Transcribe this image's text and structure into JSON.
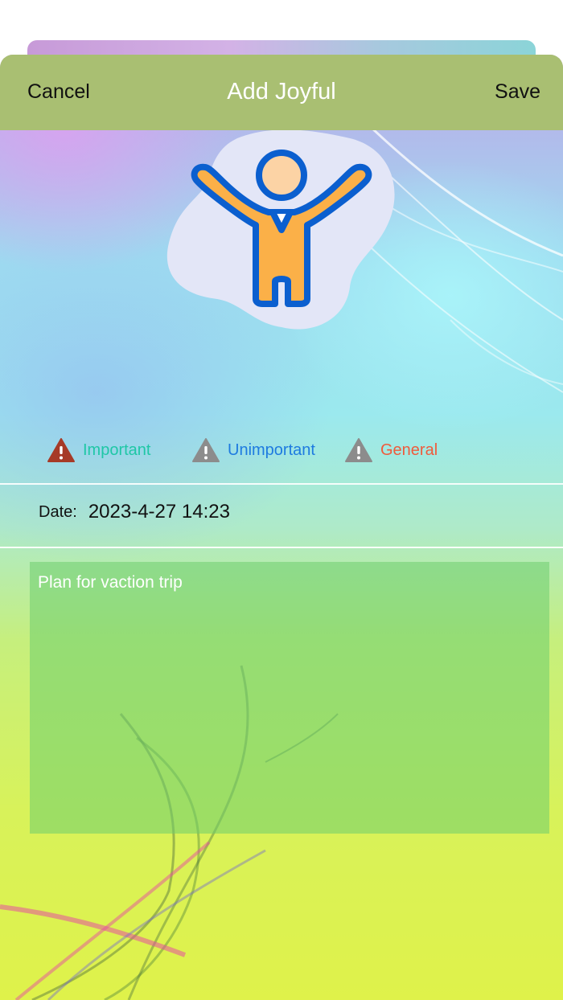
{
  "navbar": {
    "cancel_label": "Cancel",
    "title": "Add Joyful",
    "save_label": "Save",
    "background_color": "#a9bf72"
  },
  "hero": {
    "icon": "joyful-person-icon",
    "blob_color": "#e3e6f7",
    "figure_color": "#fbb048",
    "outline_color": "#0b5fcf",
    "face_color": "#fcd3a5"
  },
  "categories": [
    {
      "label": "Important",
      "icon": "warning-triangle-icon",
      "icon_color": "#a63a27",
      "text_color": "#1fc7a6"
    },
    {
      "label": "Unimportant",
      "icon": "warning-triangle-icon",
      "icon_color": "#8c8c8c",
      "text_color": "#1e7be0"
    },
    {
      "label": "General",
      "icon": "warning-triangle-icon",
      "icon_color": "#8c8c8c",
      "text_color": "#ef5b3c"
    }
  ],
  "date": {
    "label": "Date:",
    "value": "2023-4-27 14:23"
  },
  "note": {
    "text": "Plan for vaction trip"
  }
}
